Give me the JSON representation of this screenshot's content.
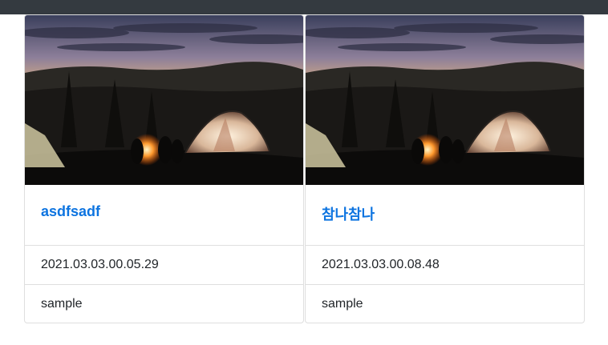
{
  "navbar": {
    "background": "#343a40"
  },
  "cards": [
    {
      "title": "asdfsadf",
      "date": "2021.03.03.00.05.29",
      "tag": "sample",
      "image": "campfire-tents-night-photo"
    },
    {
      "title": "참나참나",
      "date": "2021.03.03.00.08.48",
      "tag": "sample",
      "image": "campfire-tents-night-photo"
    }
  ],
  "colors": {
    "title_link": "#0d74e0",
    "text": "#212529"
  }
}
